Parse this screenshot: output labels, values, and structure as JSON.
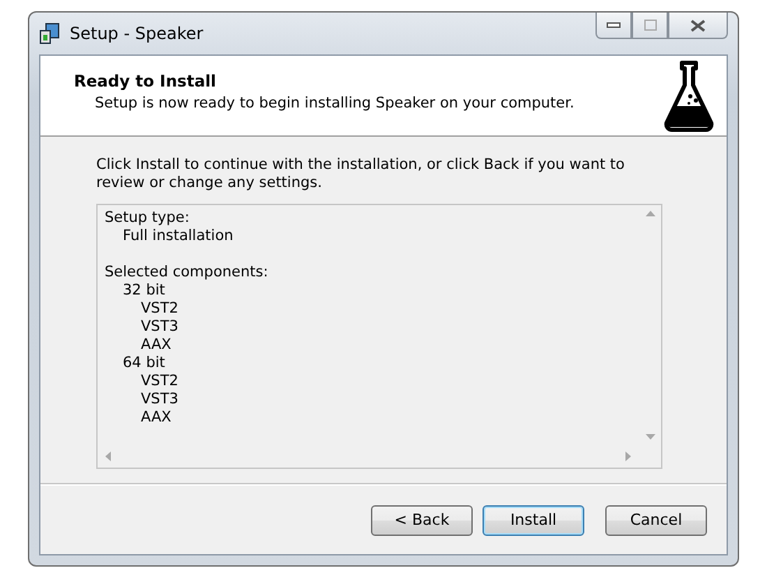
{
  "window": {
    "title": "Setup - Speaker"
  },
  "header": {
    "title": "Ready to Install",
    "subtitle": "Setup is now ready to begin installing Speaker on your computer."
  },
  "instructions": "Click Install to continue with the installation, or click Back if you want to review or change any settings.",
  "memo": [
    {
      "text": "Setup type:",
      "children": [
        {
          "text": "Full installation"
        }
      ]
    },
    {
      "text": "Selected components:",
      "children": [
        {
          "text": "32 bit",
          "children": [
            {
              "text": "VST2"
            },
            {
              "text": "VST3"
            },
            {
              "text": "AAX"
            }
          ]
        },
        {
          "text": "64 bit",
          "children": [
            {
              "text": "VST2"
            },
            {
              "text": "VST3"
            },
            {
              "text": "AAX"
            }
          ]
        }
      ]
    }
  ],
  "buttons": [
    {
      "label": "< Back",
      "default": false
    },
    {
      "label": "Install",
      "default": true
    },
    {
      "label": "Cancel",
      "default": false
    }
  ]
}
